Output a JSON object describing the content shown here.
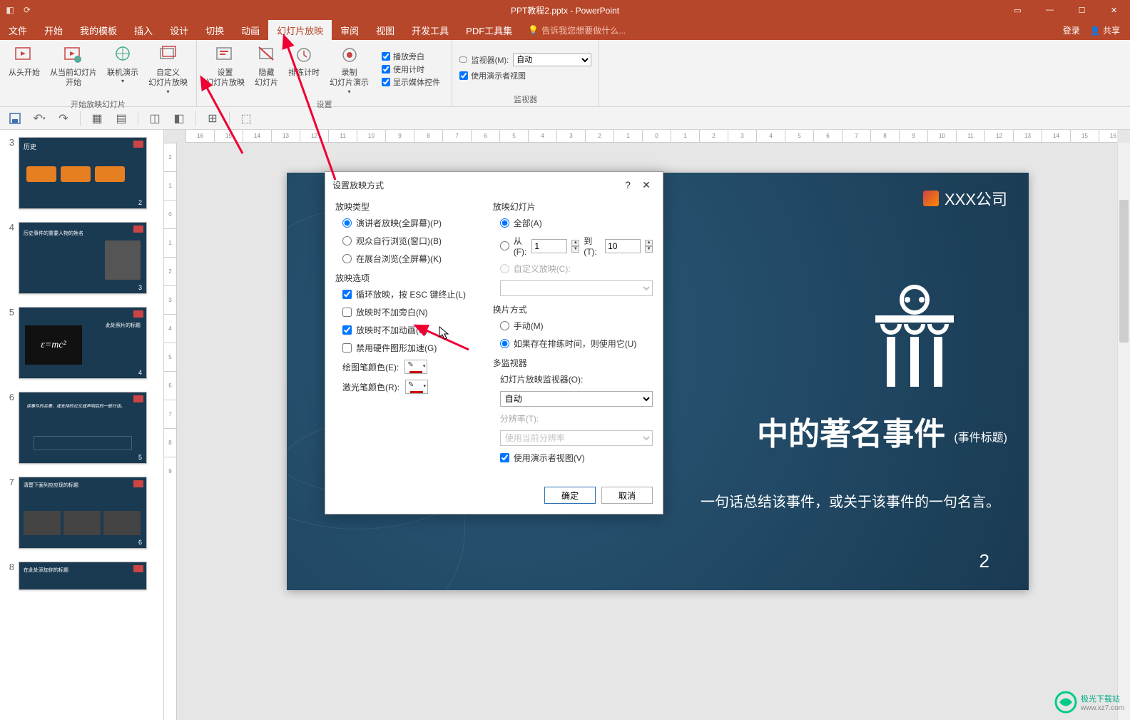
{
  "titlebar": {
    "title": "PPT教程2.pptx - PowerPoint"
  },
  "menu": {
    "file": "文件",
    "home": "开始",
    "templates": "我的模板",
    "insert": "插入",
    "design": "设计",
    "transitions": "切换",
    "animations": "动画",
    "slideshow": "幻灯片放映",
    "review": "审阅",
    "view": "视图",
    "developer": "开发工具",
    "pdf": "PDF工具集",
    "tell": "告诉我您想要做什么...",
    "login": "登录",
    "share": "共享"
  },
  "ribbon": {
    "from_beginning": "从头开始",
    "from_current": "从当前幻灯片\n开始",
    "present_online": "联机演示",
    "custom_show": "自定义\n幻灯片放映",
    "setup_show": "设置\n幻灯片放映",
    "hide_slide": "隐藏\n幻灯片",
    "rehearse": "排练计时",
    "record": "录制\n幻灯片演示",
    "play_narration": "播放旁白",
    "use_timing": "使用计时",
    "show_media": "显示媒体控件",
    "monitor_label": "监视器(M):",
    "monitor_auto": "自动",
    "presenter_view": "使用演示者视图",
    "group_start": "开始放映幻灯片",
    "group_setup": "设置",
    "group_monitor": "监视器"
  },
  "dialog": {
    "title": "设置放映方式",
    "show_type": "放映类型",
    "type_presenter": "演讲者放映(全屏幕)(P)",
    "type_individual": "观众自行浏览(窗口)(B)",
    "type_kiosk": "在展台浏览(全屏幕)(K)",
    "show_options": "放映选项",
    "loop": "循环放映，按 ESC 键终止(L)",
    "no_narration": "放映时不加旁白(N)",
    "no_animation": "放映时不加动画(S)",
    "no_hwaccel": "禁用硬件图形加速(G)",
    "pen_color": "绘图笔颜色(E):",
    "laser_color": "激光笔颜色(R):",
    "show_slides": "放映幻灯片",
    "all": "全部(A)",
    "from": "从(F):",
    "from_val": "1",
    "to": "到(T):",
    "to_val": "10",
    "custom": "自定义放映(C):",
    "advance": "换片方式",
    "manual": "手动(M)",
    "timings": "如果存在排练时间，则使用它(U)",
    "multi_monitor": "多监视器",
    "monitor_label": "幻灯片放映监视器(O):",
    "monitor_auto": "自动",
    "resolution": "分辨率(T):",
    "resolution_val": "使用当前分辨率",
    "presenter_view": "使用演示者视图(V)",
    "ok": "确定",
    "cancel": "取消"
  },
  "slide": {
    "company": "XXX公司",
    "title_part": "中的著名事件",
    "title_sub": "(事件标题)",
    "tagline": "一句话总结该事件，或关于该事件的一句名言。",
    "page": "2"
  },
  "thumbs": {
    "t3": {
      "num": "3",
      "title": "历史",
      "page": "2"
    },
    "t4": {
      "num": "4",
      "title": "历史事件的重要人物的姓名",
      "page": "3"
    },
    "t5": {
      "num": "5",
      "title": "此处照片的标题",
      "page": "4"
    },
    "t6": {
      "num": "6",
      "title": "读事件的名著，或支持的论文或声明后的一般行话。",
      "page": "5"
    },
    "t7": {
      "num": "7",
      "title": "清楚下面列应应现的标题",
      "page": "6"
    },
    "t8": {
      "num": "8",
      "title": "在此处添加你的标题"
    }
  },
  "ruler_h": [
    "16",
    "15",
    "14",
    "13",
    "12",
    "11",
    "10",
    "9",
    "8",
    "7",
    "6",
    "5",
    "4",
    "3",
    "2",
    "1",
    "0",
    "1",
    "2",
    "3",
    "4",
    "5",
    "6",
    "7",
    "8",
    "9",
    "10",
    "11",
    "12",
    "13",
    "14",
    "15",
    "16"
  ],
  "ruler_v": [
    "2",
    "1",
    "0",
    "1",
    "2",
    "3",
    "4",
    "5",
    "6",
    "7",
    "8",
    "9"
  ],
  "watermark": {
    "site": "极光下载站",
    "url": "www.xz7.com"
  }
}
